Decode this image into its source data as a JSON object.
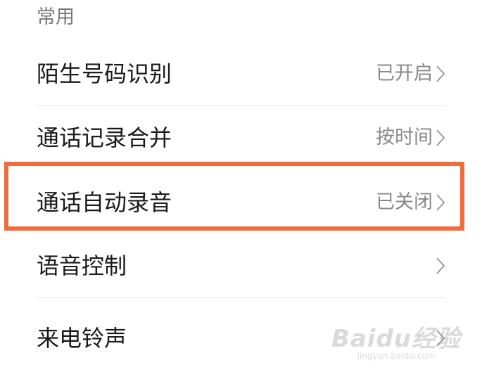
{
  "section": {
    "title": "常用"
  },
  "settings": [
    {
      "label": "陌生号码识别",
      "value": "已开启"
    },
    {
      "label": "通话记录合并",
      "value": "按时间"
    },
    {
      "label": "通话自动录音",
      "value": "已关闭"
    },
    {
      "label": "语音控制",
      "value": ""
    },
    {
      "label": "来电铃声",
      "value": ""
    }
  ],
  "highlight": {
    "color": "#f26b3a",
    "target": "通话自动录音"
  },
  "watermark": {
    "text": "Baidu经验",
    "subtext": "jingyan.baidu.com"
  },
  "icons": {
    "chevron": "chevron-right-icon"
  }
}
